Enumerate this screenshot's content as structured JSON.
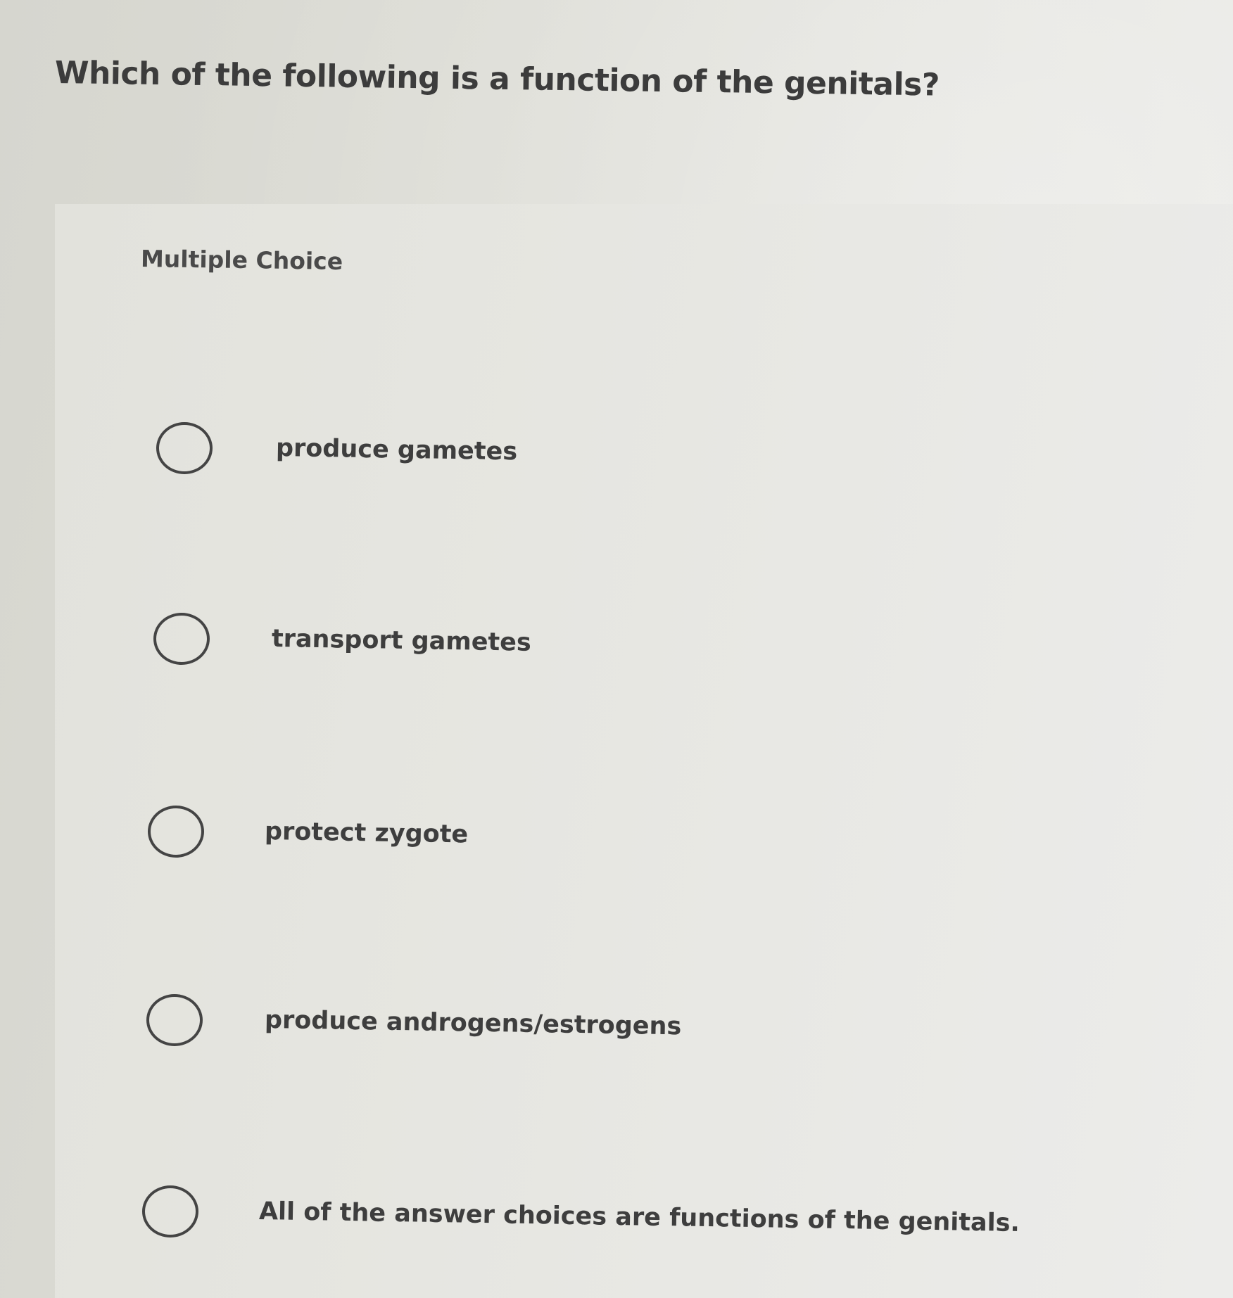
{
  "question": {
    "text": "Which of the following is a function of the genitals?"
  },
  "answer_section": {
    "type_label": "Multiple Choice",
    "options": [
      {
        "label": "produce gametes",
        "selected": false
      },
      {
        "label": "transport gametes",
        "selected": false
      },
      {
        "label": "protect zygote",
        "selected": false
      },
      {
        "label": "produce androgens/estrogens",
        "selected": false
      },
      {
        "label": "All of the answer choices are functions of the genitals.",
        "selected": false
      }
    ]
  }
}
